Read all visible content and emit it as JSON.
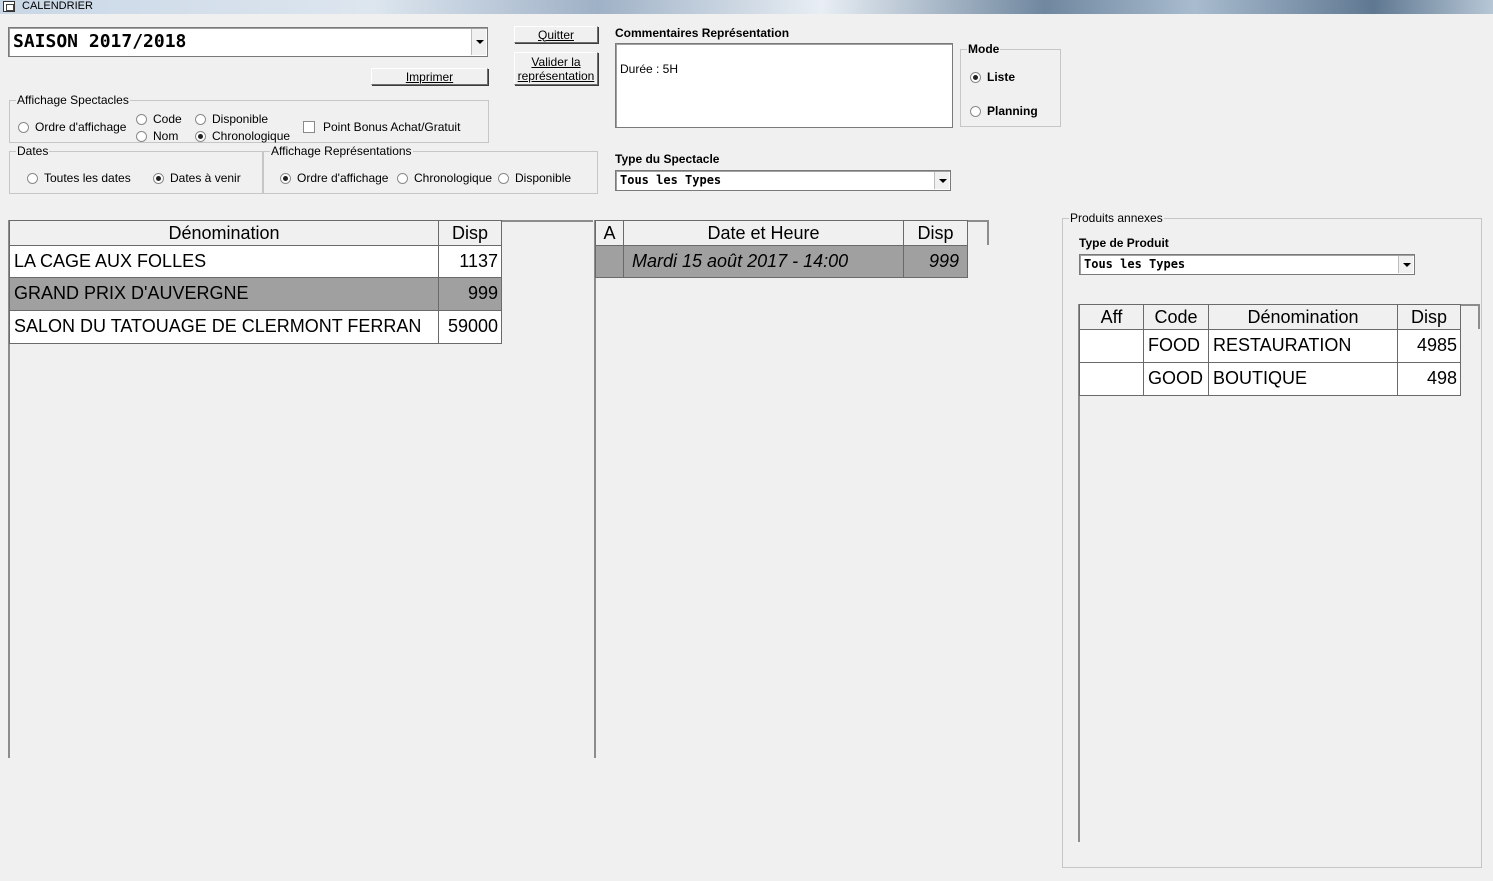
{
  "window": {
    "title": "CALENDRIER"
  },
  "season": {
    "value": "SAISON 2017/2018"
  },
  "buttons": {
    "quit": "Quitter",
    "validate_line1": "Valider la",
    "validate_line2": "représentation",
    "print": "Imprimer"
  },
  "affichage_spectacles": {
    "legend": "Affichage Spectacles",
    "options": [
      {
        "label": "Ordre d'affichage",
        "selected": false
      },
      {
        "label": "Code",
        "selected": false
      },
      {
        "label": "Nom",
        "selected": false
      },
      {
        "label": "Disponible",
        "selected": false
      },
      {
        "label": "Chronologique",
        "selected": true
      }
    ],
    "bonus_checkbox": {
      "label": "Point Bonus Achat/Gratuit",
      "checked": false
    }
  },
  "dates": {
    "legend": "Dates",
    "options": [
      {
        "label": "Toutes les dates",
        "selected": false
      },
      {
        "label": "Dates à venir",
        "selected": true
      }
    ]
  },
  "affichage_representations": {
    "legend": "Affichage Représentations",
    "options": [
      {
        "label": "Ordre d'affichage",
        "selected": true
      },
      {
        "label": "Chronologique",
        "selected": false
      },
      {
        "label": "Disponible",
        "selected": false
      }
    ]
  },
  "comments": {
    "label": "Commentaires Représentation",
    "text": "Durée : 5H"
  },
  "mode": {
    "legend": "Mode",
    "options": [
      {
        "label": "Liste",
        "selected": true
      },
      {
        "label": "Planning",
        "selected": false
      }
    ]
  },
  "type_spectacle": {
    "label": "Type du Spectacle",
    "value": "Tous les Types"
  },
  "shows_table": {
    "headers": [
      "Dénomination",
      "Disp"
    ],
    "rows": [
      {
        "name": "LA CAGE AUX FOLLES",
        "disp": "1137",
        "selected": false
      },
      {
        "name": "GRAND PRIX D'AUVERGNE",
        "disp": "999",
        "selected": true
      },
      {
        "name": "SALON DU TATOUAGE DE CLERMONT FERRAN",
        "disp": "59000",
        "selected": false
      }
    ]
  },
  "representations_table": {
    "headers": [
      "A",
      "Date et Heure",
      "Disp"
    ],
    "rows": [
      {
        "a": "",
        "date": "Mardi 15 août 2017  -  14:00",
        "disp": "999",
        "selected": true
      }
    ]
  },
  "produits_annexes": {
    "legend": "Produits annexes",
    "type_label": "Type de Produit",
    "type_value": "Tous les Types",
    "headers": [
      "Aff",
      "Code",
      "Dénomination",
      "Disp"
    ],
    "rows": [
      {
        "aff": "",
        "code": "FOOD",
        "name": "RESTAURATION",
        "disp": "4985"
      },
      {
        "aff": "",
        "code": "GOOD",
        "name": "BOUTIQUE",
        "disp": "498"
      }
    ]
  }
}
